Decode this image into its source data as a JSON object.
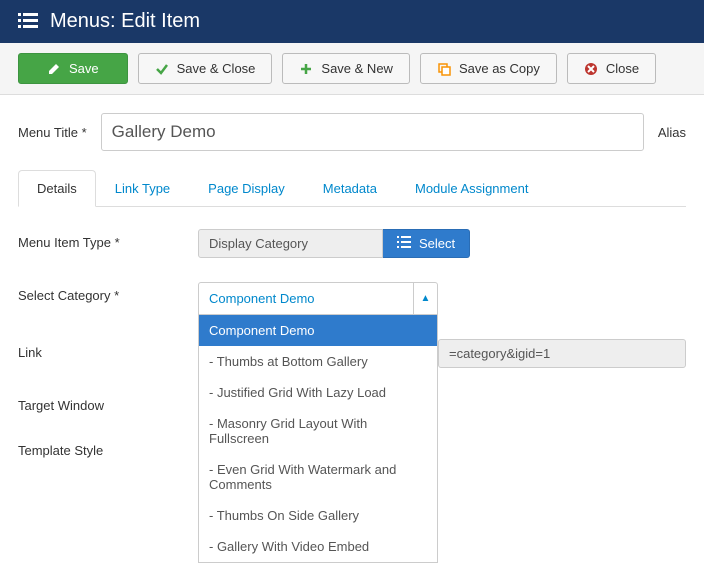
{
  "header": {
    "title": "Menus: Edit Item"
  },
  "toolbar": {
    "save": "Save",
    "saveClose": "Save & Close",
    "saveNew": "Save & New",
    "saveCopy": "Save as Copy",
    "close": "Close"
  },
  "titleRow": {
    "label": "Menu Title *",
    "value": "Gallery Demo",
    "aliasLabel": "Alias"
  },
  "tabs": {
    "items": [
      {
        "label": "Details",
        "active": true
      },
      {
        "label": "Link Type",
        "active": false
      },
      {
        "label": "Page Display",
        "active": false
      },
      {
        "label": "Metadata",
        "active": false
      },
      {
        "label": "Module Assignment",
        "active": false
      }
    ]
  },
  "form": {
    "menuItemType": {
      "label": "Menu Item Type *",
      "value": "Display Category",
      "selectBtn": "Select"
    },
    "selectCategory": {
      "label": "Select Category *",
      "selected": "Component Demo",
      "options": [
        "Component Demo",
        "- Thumbs at Bottom Gallery",
        "- Justified Grid With Lazy Load",
        "- Masonry Grid Layout With Fullscreen",
        "- Even Grid With Watermark and Comments",
        "- Thumbs On Side Gallery",
        "- Gallery With Video Embed"
      ]
    },
    "link": {
      "label": "Link",
      "value": "=category&igid=1"
    },
    "targetWindow": {
      "label": "Target Window"
    },
    "templateStyle": {
      "label": "Template Style"
    }
  }
}
